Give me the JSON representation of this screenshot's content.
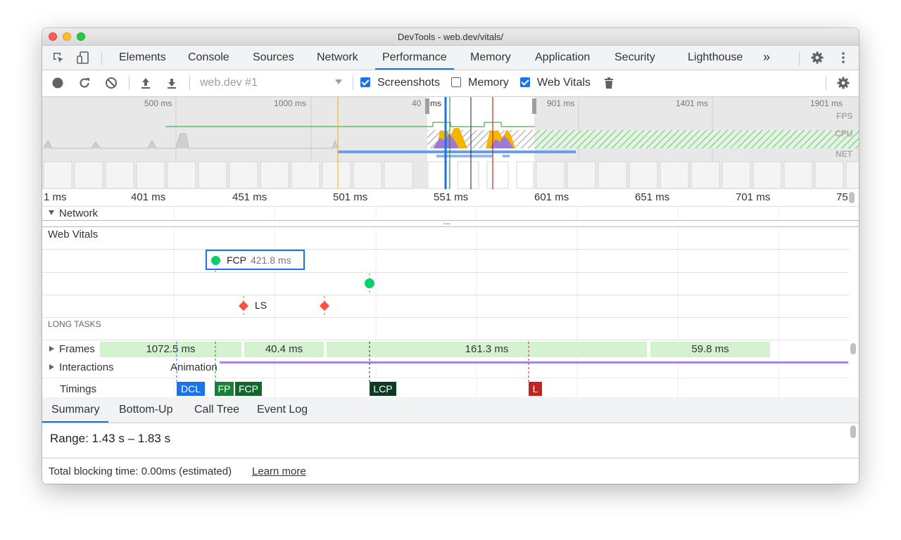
{
  "window": {
    "title": "DevTools - web.dev/vitals/"
  },
  "tabs": [
    "Elements",
    "Console",
    "Sources",
    "Network",
    "Performance",
    "Memory",
    "Application",
    "Security",
    "Lighthouse"
  ],
  "more_tabs": "»",
  "toolbar": {
    "profile_select": "web.dev #1",
    "screenshots": {
      "label": "Screenshots",
      "checked": true
    },
    "memory": {
      "label": "Memory",
      "checked": false
    },
    "web_vitals": {
      "label": "Web Vitals",
      "checked": true
    }
  },
  "overview": {
    "time_labels": [
      "500 ms",
      "1000 ms",
      "40",
      "ms",
      "901 ms",
      "1401 ms",
      "1901 ms"
    ],
    "lanes": [
      "FPS",
      "CPU",
      "NET"
    ]
  },
  "ruler": {
    "labels": [
      "1 ms",
      "401 ms",
      "451 ms",
      "501 ms",
      "551 ms",
      "601 ms",
      "651 ms",
      "701 ms",
      "75"
    ]
  },
  "network": {
    "label": "Network",
    "ellipsis": "..."
  },
  "web_vitals": {
    "title": "Web Vitals",
    "fcp": {
      "label": "FCP",
      "value": "421.8 ms"
    },
    "ls": {
      "label": "LS"
    },
    "long_tasks": "LONG TASKS"
  },
  "frames": {
    "label": "Frames",
    "values": [
      "1072.5 ms",
      "40.4 ms",
      "161.3 ms",
      "59.8 ms"
    ]
  },
  "interactions": {
    "label": "Interactions",
    "animation": "Animation"
  },
  "timings": {
    "label": "Timings",
    "markers": [
      "DCL",
      "FP",
      "FCP",
      "LCP",
      "L"
    ]
  },
  "bottom_tabs": [
    "Summary",
    "Bottom-Up",
    "Call Tree",
    "Event Log"
  ],
  "summary": {
    "range": "Range: 1.43 s – 1.83 s"
  },
  "footer": {
    "tbt": "Total blocking time: 0.00ms (estimated)",
    "learn_more": "Learn more"
  },
  "colors": {
    "accent": "#1a73e8",
    "good": "#0cce6b",
    "poor": "#ff4e42",
    "dcl": "#1a73e8",
    "fp": "#188038",
    "lcp": "#0d3b24",
    "load": "#c5221f"
  }
}
